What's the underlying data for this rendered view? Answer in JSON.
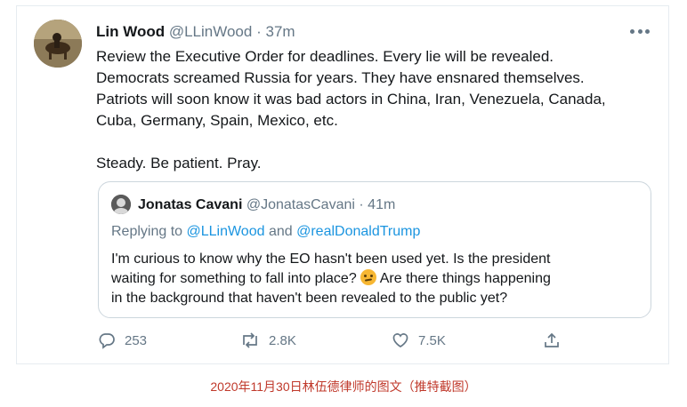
{
  "tweet": {
    "author_name": "Lin Wood",
    "author_handle": "@LLinWood",
    "separator": "·",
    "time": "37m",
    "lines": [
      "Review the Executive Order for deadlines. Every lie will be revealed.",
      "Democrats screamed Russia for years. They have ensnared themselves.",
      "Patriots will soon know it was bad actors in China, Iran, Venezuela, Canada,",
      "Cuba, Germany, Spain, Mexico, etc."
    ],
    "closing_line": "Steady. Be patient. Pray."
  },
  "quote": {
    "author_name": "Jonatas Cavani",
    "author_handle": "@JonatasCavani",
    "separator": "·",
    "time": "41m",
    "replying_prefix": "Replying to",
    "reply_user_1": "@LLinWood",
    "reply_and": "and",
    "reply_user_2": "@realDonaldTrump",
    "line_1": "I'm curious to know why the EO hasn't been used yet. Is the president",
    "line_2_before_emoji": "waiting for something to fall into place?",
    "line_2_after_emoji": "Are there things happening",
    "line_3": "in the background that haven't been revealed to the public yet?"
  },
  "actions": {
    "replies": "253",
    "retweets": "2.8K",
    "likes": "7.5K"
  },
  "caption": "2020年11月30日林伍德律师的图文（推特截图）",
  "colors": {
    "link": "#1b95e0",
    "muted": "#657786",
    "text": "#14171a",
    "caption": "#c0392b"
  },
  "icons": [
    "reply-icon",
    "retweet-icon",
    "like-icon",
    "share-icon",
    "more-icon",
    "thinking-emoji"
  ]
}
